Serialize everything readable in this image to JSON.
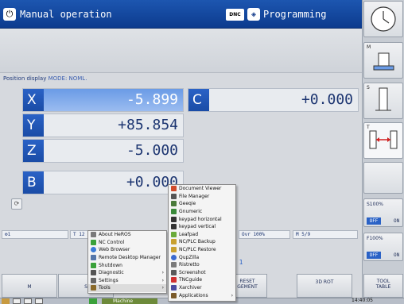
{
  "header": {
    "mode_left": "Manual operation",
    "dnc_badge": "DNC",
    "mode_right": "Programming"
  },
  "position_display": {
    "label": "Position display",
    "mode": "MODE: NOML."
  },
  "axes": [
    {
      "axis": "X",
      "value": "-5.899",
      "selected": true
    },
    {
      "axis": "Y",
      "value": "+85.854",
      "selected": false
    },
    {
      "axis": "Z",
      "value": "-5.000",
      "selected": false
    },
    {
      "axis": "B",
      "value": "+0.000",
      "selected": false
    }
  ],
  "axis_c": {
    "axis": "C",
    "value": "+0.000"
  },
  "status_bar": {
    "tool_left": "T 12",
    "override": "Ovr 100%",
    "mfunc": "M 5/9",
    "t_label": "T 1"
  },
  "right_softkeys": {
    "m_label": "M",
    "s_label": "S",
    "t_label": "T",
    "spindle_override": "S100%",
    "feed_override": "F100%",
    "off_label": "OFF",
    "on_label": "ON"
  },
  "bottom_softkeys": {
    "m": "M",
    "s": "S",
    "reset_line1": "RESET",
    "reset_line2": "GEMENT",
    "rot_3d": "3D ROT",
    "tool_line1": "TOOL",
    "tool_line2": "TABLE"
  },
  "taskbar": {
    "machine_button": "Machine",
    "applications": "Applications",
    "clock": "14:40:05"
  },
  "start_menu": [
    {
      "label": "About HeROS",
      "icon_color": "#7a7a7a"
    },
    {
      "label": "NC Control",
      "icon_color": "#3aa13a"
    },
    {
      "label": "Web Browser",
      "icon_color": "#3b7bd6"
    },
    {
      "label": "Remote Desktop Manager",
      "icon_color": "#5577aa"
    },
    {
      "label": "Shutdown",
      "icon_color": "#3aa13a"
    },
    {
      "label": "Diagnostic",
      "icon_color": "#555555",
      "submenu": true
    },
    {
      "label": "Settings",
      "icon_color": "#666666",
      "submenu": true
    },
    {
      "label": "Tools",
      "icon_color": "#8a6a2a",
      "submenu": true,
      "highlighted": true
    }
  ],
  "tools_submenu": [
    {
      "label": "Document Viewer",
      "icon_color": "#d04a2a"
    },
    {
      "label": "File Manager",
      "icon_color": "#555555"
    },
    {
      "label": "Geeqie",
      "icon_color": "#4a7a3a"
    },
    {
      "label": "Gnumeric",
      "icon_color": "#3a8a3a"
    },
    {
      "label": "keypad horizontal",
      "icon_color": "#333333"
    },
    {
      "label": "keypad vertical",
      "icon_color": "#333333"
    },
    {
      "label": "Leafpad",
      "icon_color": "#6aaa3a"
    },
    {
      "label": "NC/PLC Backup",
      "icon_color": "#c8a030"
    },
    {
      "label": "NC/PLC Restore",
      "icon_color": "#c8a030"
    },
    {
      "label": "QupZilla",
      "icon_color": "#3a6ad0"
    },
    {
      "label": "Ristretto",
      "icon_color": "#7a7a7a"
    },
    {
      "label": "Screenshot",
      "icon_color": "#5a5a5a"
    },
    {
      "label": "TNCguide",
      "icon_color": "#d03030"
    },
    {
      "label": "Xarchiver",
      "icon_color": "#4a4aa0"
    },
    {
      "label": "Applications",
      "icon_color": "#7a5a2a",
      "submenu": true
    }
  ],
  "colors": {
    "accent_blue": "#1a4ca6",
    "selected_row": "#6a9be6",
    "background": "#d6d9de"
  },
  "icons": {
    "power": "power-icon",
    "programming": "program-icon",
    "clock": "clock-icon"
  }
}
